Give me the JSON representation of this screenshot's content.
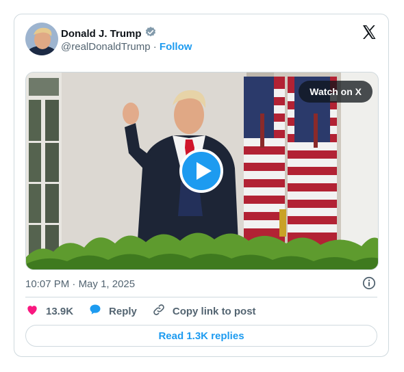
{
  "author": {
    "name": "Donald J. Trump",
    "handle": "@realDonaldTrump",
    "separator": "·",
    "follow_label": "Follow"
  },
  "media": {
    "watch_label": "Watch on X"
  },
  "meta": {
    "time": "10:07 PM",
    "separator": "·",
    "date": "May 1, 2025"
  },
  "actions": {
    "likes": "13.9K",
    "reply_label": "Reply",
    "copy_label": "Copy link to post"
  },
  "replies_button": "Read 1.3K replies",
  "colors": {
    "accent": "#1d9bf0",
    "like": "#f91880",
    "text_secondary": "#536471",
    "border": "#cfd9de"
  }
}
